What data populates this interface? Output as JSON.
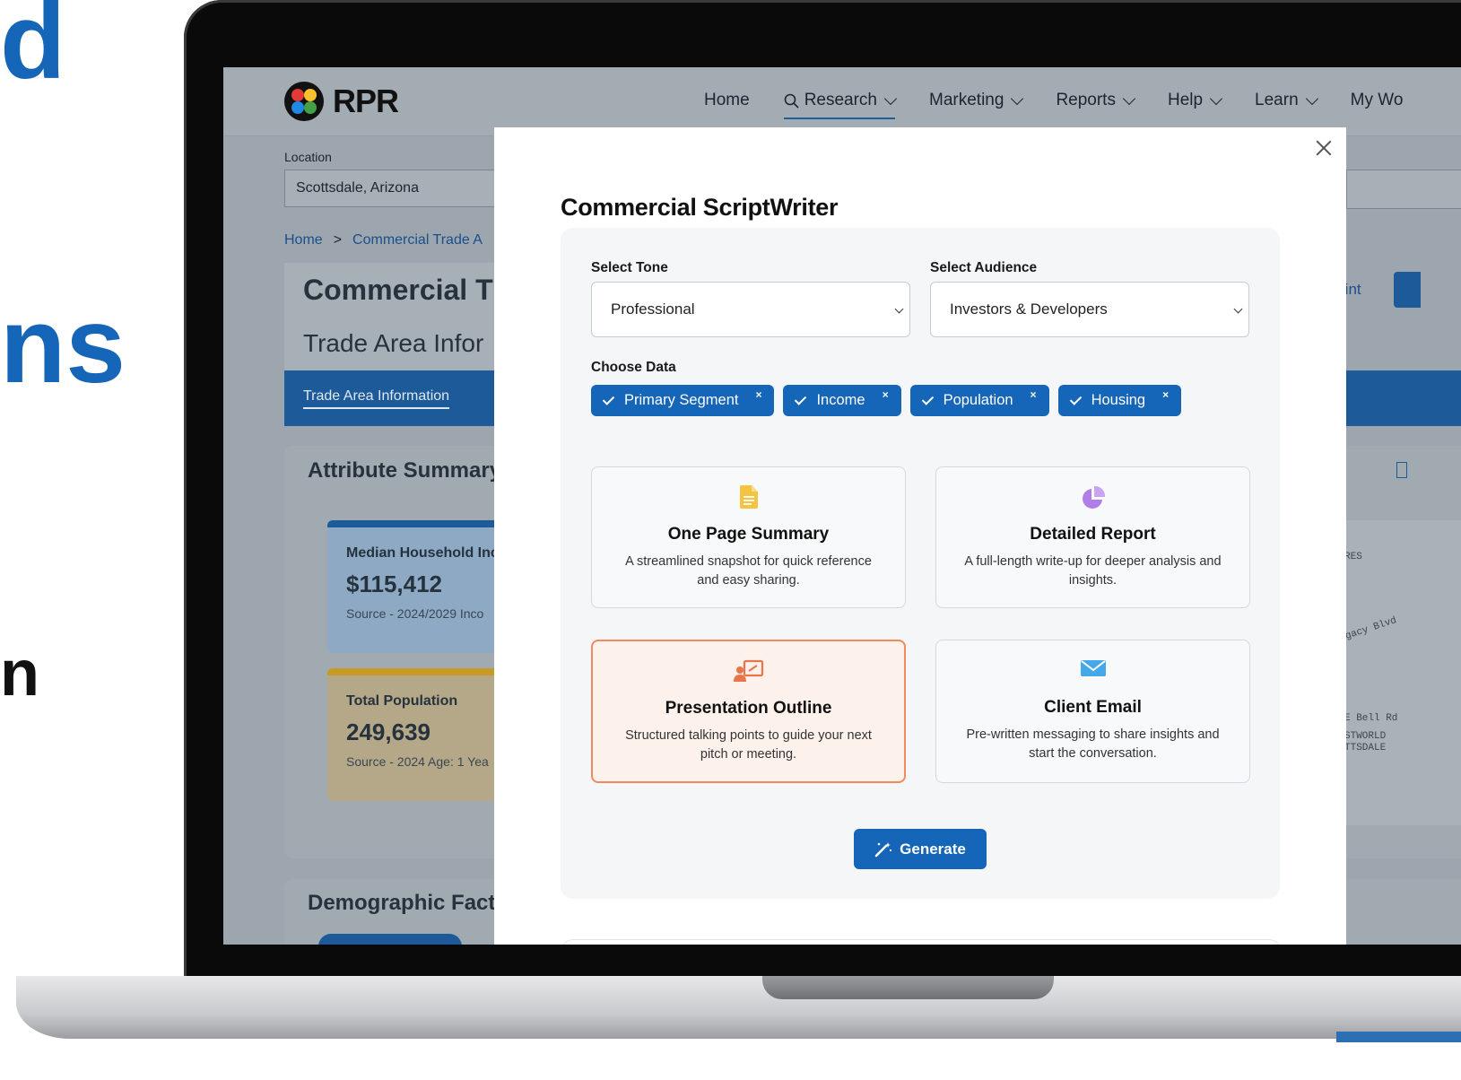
{
  "marketing": {
    "line1": "d",
    "line2": "ns",
    "line3": "n"
  },
  "app": {
    "logo_text": "RPR",
    "nav": [
      {
        "label": "Home",
        "dropdown": false
      },
      {
        "label": "Research",
        "dropdown": true,
        "active": true
      },
      {
        "label": "Marketing",
        "dropdown": true
      },
      {
        "label": "Reports",
        "dropdown": true
      },
      {
        "label": "Help",
        "dropdown": true
      },
      {
        "label": "Learn",
        "dropdown": true
      },
      {
        "label": "My Wo",
        "dropdown": false
      }
    ],
    "location_label": "Location",
    "location_value": "Scottsdale, Arizona",
    "breadcrumb": [
      "Home",
      "Commercial Trade A"
    ],
    "page_title": "Commercial T",
    "page_subtitle": "Trade Area Infor",
    "tab_label": "Trade Area Information",
    "attribute_summary_title": "Attribute Summary",
    "stats": [
      {
        "label": "Median Household Inc",
        "value": "$115,412",
        "source": "Source - 2024/2029 Inco"
      },
      {
        "label": "Total Population",
        "value": "249,639",
        "source": "Source - 2024 Age: 1 Yea"
      }
    ],
    "demographic_title": "Demographic Fact",
    "right_print": "rint",
    "map_labels": [
      "RES",
      "gacy Blvd",
      "E Bell Rd",
      "STWORLD",
      "TTSDALE"
    ]
  },
  "modal": {
    "title": "Commercial ScriptWriter",
    "tone_label": "Select Tone",
    "tone_value": "Professional",
    "audience_label": "Select Audience",
    "audience_value": "Investors & Developers",
    "data_label": "Choose Data",
    "chips": [
      "Primary Segment",
      "Income",
      "Population",
      "Housing"
    ],
    "chip_remove": "×",
    "options": [
      {
        "title": "One Page Summary",
        "desc": "A streamlined snapshot for quick reference and easy sharing.",
        "icon": "document-icon",
        "selected": false
      },
      {
        "title": "Detailed Report",
        "desc": "A full-length write-up for deeper analysis and insights.",
        "icon": "pie-chart-icon",
        "selected": false
      },
      {
        "title": "Presentation Outline",
        "desc": "Structured talking points to guide your next pitch or meeting.",
        "icon": "presentation-icon",
        "selected": true
      },
      {
        "title": "Client Email",
        "desc": "Pre-written messaging to share insights and start the conversation.",
        "icon": "envelope-icon",
        "selected": false
      }
    ],
    "generate_label": "Generate"
  },
  "colors": {
    "brand_blue": "#1565b8",
    "selected_border": "#f08a5d",
    "selected_bg": "#fdf1ec",
    "doc_icon": "#f5c342",
    "pie_icon": "#b07ee6",
    "presentation_icon": "#e8764a",
    "email_icon": "#45a8e8"
  }
}
